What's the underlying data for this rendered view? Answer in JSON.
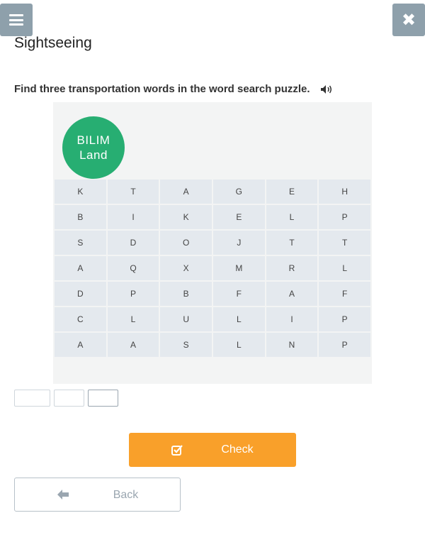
{
  "header": {
    "menu_icon": "hamburger-menu-icon",
    "close_icon": "close-x-icon",
    "title": "Sightseeing"
  },
  "instruction": {
    "text": "Find three transportation words in the word search puzzle.",
    "audio_icon": "speaker-icon"
  },
  "logo": {
    "line1": "BILIM",
    "line2": "Land",
    "color": "#27ae72"
  },
  "grid": {
    "rows": [
      [
        "K",
        "T",
        "A",
        "G",
        "E",
        "H"
      ],
      [
        "B",
        "I",
        "K",
        "E",
        "L",
        "P"
      ],
      [
        "S",
        "D",
        "O",
        "J",
        "T",
        "T"
      ],
      [
        "A",
        "Q",
        "X",
        "M",
        "R",
        "L"
      ],
      [
        "D",
        "P",
        "B",
        "F",
        "A",
        "F"
      ],
      [
        "C",
        "L",
        "U",
        "L",
        "I",
        "P"
      ],
      [
        "A",
        "A",
        "S",
        "L",
        "N",
        "P"
      ]
    ]
  },
  "answers": {
    "values": [
      "",
      "",
      ""
    ],
    "placeholders": [
      "",
      "",
      ""
    ]
  },
  "actions": {
    "check_label": "Check",
    "check_icon": "checkbox-check-icon",
    "back_label": "Back",
    "back_icon": "arrow-left-icon",
    "accent": "#f9a02a"
  }
}
